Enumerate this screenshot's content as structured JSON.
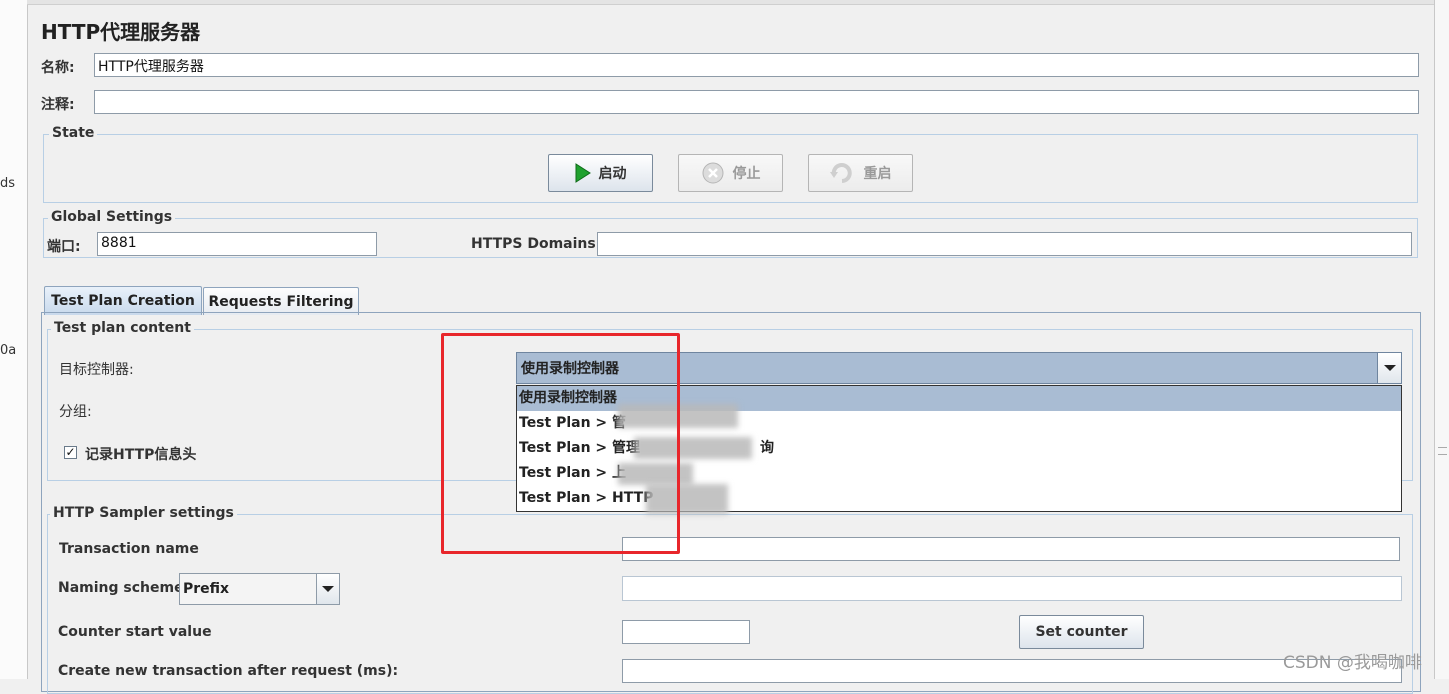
{
  "window": {
    "title": "HTTP代理服务器",
    "left_stub_1": "ds",
    "left_stub_2": "0a"
  },
  "form": {
    "name_label": "名称:",
    "name_value": "HTTP代理服务器",
    "comment_label": "注释:",
    "comment_value": ""
  },
  "state": {
    "legend": "State",
    "start_label": "启动",
    "stop_label": "停止",
    "restart_label": "重启"
  },
  "global_settings": {
    "legend": "Global Settings",
    "port_label": "端口:",
    "port_value": "8881",
    "https_label": "HTTPS Domains:",
    "https_value": ""
  },
  "tabs": [
    {
      "label": "Test Plan Creation",
      "active": true
    },
    {
      "label": "Requests Filtering",
      "active": false
    }
  ],
  "test_plan_content": {
    "legend": "Test plan content",
    "target_controller_label": "目标控制器:",
    "target_controller_value": "使用录制控制器",
    "grouping_label": "分组:",
    "record_headers_label": "记录HTTP信息头",
    "record_headers_checked": true,
    "dropdown_options": [
      "使用录制控制器",
      "Test Plan > 管",
      "Test Plan > 管理",
      "Test Plan > 上",
      "Test Plan > HTTP"
    ],
    "dropdown_option_tail": "询"
  },
  "http_sampler": {
    "legend": "HTTP Sampler settings",
    "transaction_name_label": "Transaction name",
    "transaction_name_value": "",
    "naming_scheme_label": "Naming scheme",
    "naming_scheme_value": "Prefix",
    "counter_start_label": "Counter start value",
    "counter_start_value": "",
    "set_counter_label": "Set counter",
    "create_after_label": "Create new transaction after request (ms):"
  },
  "watermark": "CSDN @我喝咖啡",
  "colors": {
    "annotation_red": "#e8262b",
    "selection_blue": "#a9bcd3",
    "play_green": "#1fa12e"
  }
}
